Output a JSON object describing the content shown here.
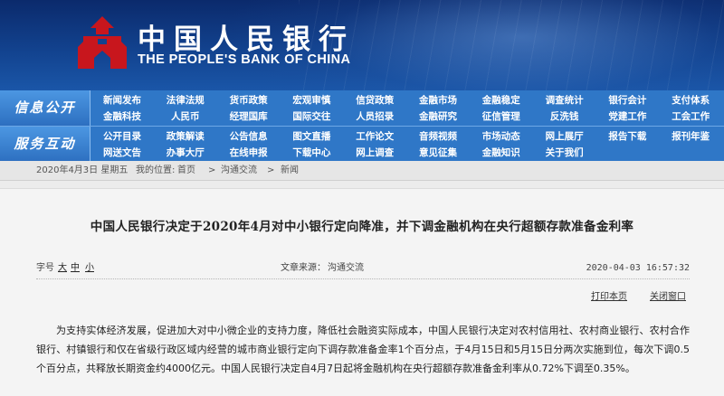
{
  "header": {
    "logo_cn": "中国人民银行",
    "logo_en": "THE PEOPLE'S BANK OF CHINA",
    "brand_color": "#c8161d"
  },
  "nav": {
    "sections": [
      {
        "label": "信息公开",
        "rows": [
          [
            "新闻发布",
            "法律法规",
            "货币政策",
            "宏观审慎",
            "信贷政策",
            "金融市场",
            "金融稳定",
            "调查统计",
            "银行会计",
            "支付体系"
          ],
          [
            "金融科技",
            "人民币",
            "经理国库",
            "国际交往",
            "人员招录",
            "金融研究",
            "征信管理",
            "反洗钱",
            "党建工作",
            "工会工作"
          ]
        ]
      },
      {
        "label": "服务互动",
        "rows": [
          [
            "公开目录",
            "政策解读",
            "公告信息",
            "图文直播",
            "工作论文",
            "音频视频",
            "市场动态",
            "网上展厅",
            "报告下载",
            "报刊年鉴"
          ],
          [
            "网送文告",
            "办事大厅",
            "在线申报",
            "下载中心",
            "网上调查",
            "意见征集",
            "金融知识",
            "关于我们"
          ]
        ]
      }
    ]
  },
  "breadcrumb": {
    "date": "2020年4月3日 星期五",
    "location_label": "我的位置:",
    "home": "首页",
    "sep": ">",
    "channel": "沟通交流",
    "current": "新闻"
  },
  "article": {
    "title": "中国人民银行决定于2020年4月对中小银行定向降准，并下调金融机构在央行超额存款准备金利率",
    "font_size_label": "字号",
    "font_size_large": "大",
    "font_size_medium": "中",
    "font_size_small": "小",
    "source_label": "文章来源：",
    "source_value": "沟通交流",
    "date": "2020-04-03 16:57:32",
    "print_label": "打印本页",
    "close_label": "关闭窗口",
    "body": "为支持实体经济发展，促进加大对中小微企业的支持力度，降低社会融资实际成本，中国人民银行决定对农村信用社、农村商业银行、农村合作银行、村镇银行和仅在省级行政区域内经营的城市商业银行定向下调存款准备金率1个百分点，于4月15日和5月15日分两次实施到位，每次下调0.5个百分点，共释放长期资金约4000亿元。中国人民银行决定自4月7日起将金融机构在央行超额存款准备金利率从0.72%下调至0.35%。"
  }
}
